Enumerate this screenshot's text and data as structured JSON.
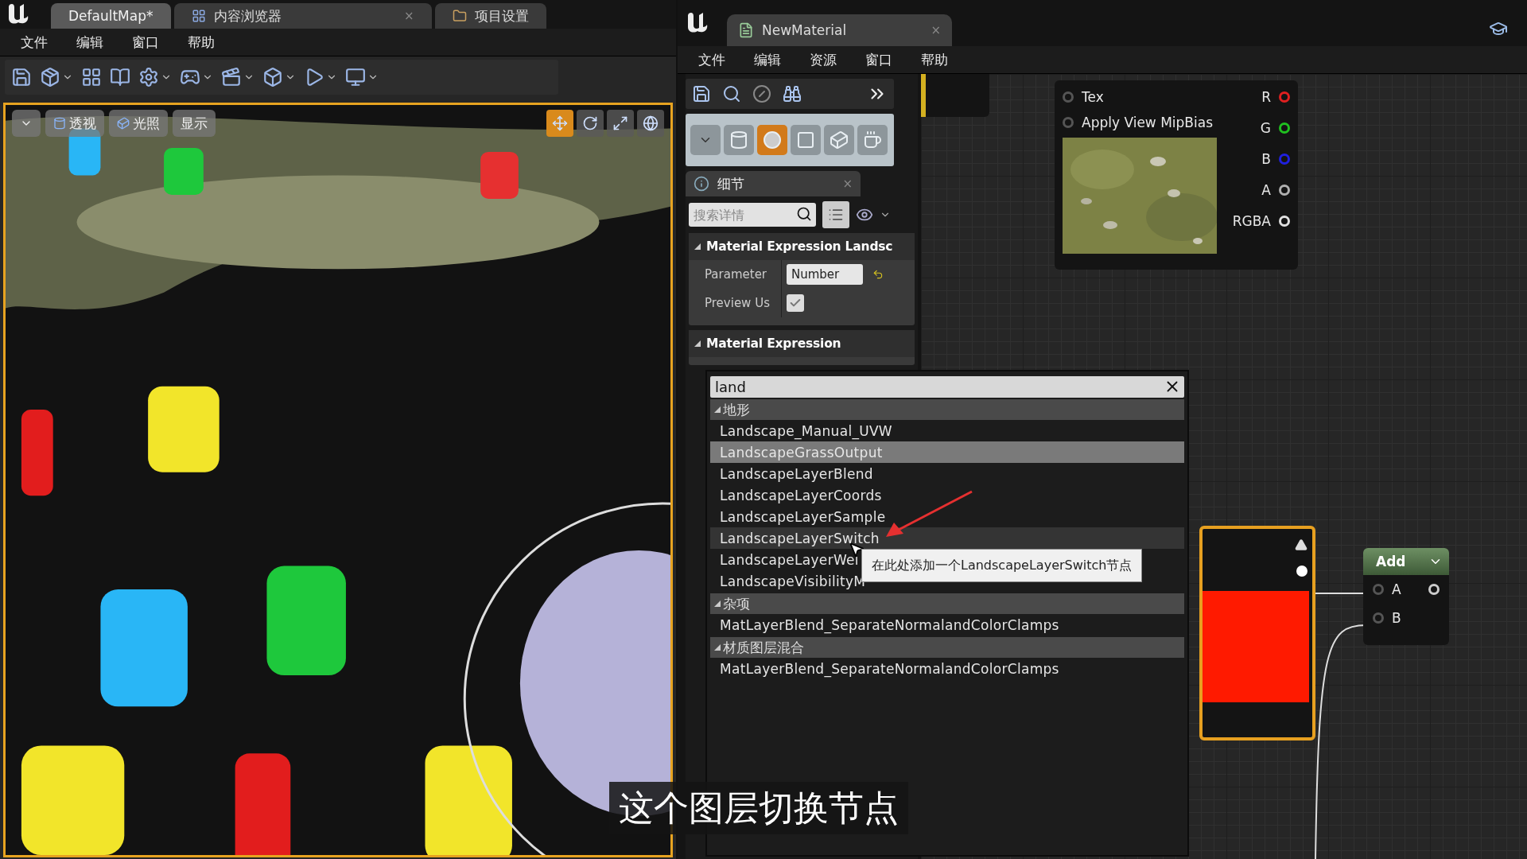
{
  "level_editor": {
    "tabs": [
      {
        "label": "DefaultMap*",
        "selected": true
      },
      {
        "label": "内容浏览器",
        "selected": false,
        "close": "×"
      },
      {
        "label": "项目设置",
        "selected": false
      }
    ],
    "menu": [
      "文件",
      "编辑",
      "窗口",
      "帮助"
    ],
    "viewport": {
      "buttons": [
        "透视",
        "光照",
        "显示"
      ]
    }
  },
  "material_editor": {
    "tab": {
      "label": "NewMaterial",
      "close": "×"
    },
    "menu": [
      "文件",
      "编辑",
      "资源",
      "窗口",
      "帮助"
    ],
    "details": {
      "title": "细节",
      "close": "×",
      "search": {
        "placeholder": "搜索详情"
      },
      "sections": [
        {
          "title": "Material Expression Landsc",
          "expanded": true,
          "rows": [
            {
              "kind": "text",
              "label": "Parameter",
              "value": "Number"
            },
            {
              "kind": "checkbox",
              "label": "Preview Us",
              "checked": true
            }
          ]
        },
        {
          "title": "Material Expression",
          "expanded": true
        }
      ]
    },
    "texture_node": {
      "inputs": [
        "Tex",
        "Apply View MipBias"
      ],
      "outputs": [
        {
          "label": "R",
          "color": "#e02020"
        },
        {
          "label": "G",
          "color": "#20c020"
        },
        {
          "label": "B",
          "color": "#2020e0"
        },
        {
          "label": "A",
          "color": "#b0b0b0"
        },
        {
          "label": "RGBA",
          "color": "#e0e0e0"
        }
      ]
    },
    "add_node": {
      "title": "Add",
      "inputs": [
        "A",
        "B"
      ]
    }
  },
  "palette": {
    "search": {
      "value": "land"
    },
    "groups": [
      {
        "title": "地形",
        "expanded": true,
        "items": [
          {
            "label": "Landscape_Manual_UVW",
            "selected": false,
            "hovered": false
          },
          {
            "label": "LandscapeGrassOutput",
            "selected": true,
            "hovered": false
          },
          {
            "label": "LandscapeLayerBlend",
            "selected": false,
            "hovered": false
          },
          {
            "label": "LandscapeLayerCoords",
            "selected": false,
            "hovered": false
          },
          {
            "label": "LandscapeLayerSample",
            "selected": false,
            "hovered": false
          },
          {
            "label": "LandscapeLayerSwitch",
            "selected": false,
            "hovered": true
          },
          {
            "label": "LandscapeLayerWei",
            "selected": false,
            "hovered": false
          },
          {
            "label": "LandscapeVisibilityM",
            "selected": false,
            "hovered": false
          }
        ]
      },
      {
        "title": "杂项",
        "expanded": true,
        "items": [
          {
            "label": "MatLayerBlend_SeparateNormalandColorClamps",
            "selected": false,
            "hovered": false
          }
        ]
      },
      {
        "title": "材质图层混合",
        "expanded": true,
        "items": [
          {
            "label": "MatLayerBlend_SeparateNormalandColorClamps",
            "selected": false,
            "hovered": false
          }
        ]
      }
    ],
    "tooltip": "在此处添加一个LandscapeLayerSwitch节点"
  },
  "subtitle": "这个图层切换节点"
}
